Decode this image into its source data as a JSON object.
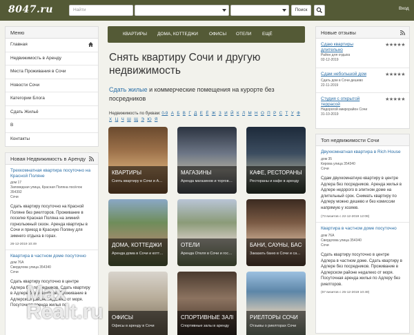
{
  "header": {
    "logo": "8047.ru",
    "search_placeholder": "Найти",
    "search_button": "Поиск",
    "login": "Вход"
  },
  "left_menu": {
    "title": "Меню",
    "items": [
      {
        "label": "Главная"
      },
      {
        "label": "Недвижимость в Аренду"
      },
      {
        "label": "Места Проживания в Сочи"
      },
      {
        "label": "Новости Сочи"
      },
      {
        "label": "Категории Блога"
      },
      {
        "label": "Сдать Жильё"
      },
      {
        "label": "В"
      },
      {
        "label": "Контакты"
      }
    ]
  },
  "new_listings": {
    "title": "Новая Недвижимость в Аренду",
    "items": [
      {
        "title": "Трехкомнатная квартира посуточно на Красной Поляне",
        "line1": "дом 17",
        "line2": "Заповедная улица, Красная Поляна посёлок",
        "line3": "354392",
        "line4": "Сочи",
        "text": "Сдать квартиру посуточно на Красной Поляне без риелторов. Проживание в поселке Красная Поляна на зимний горнолыжный сезон. Аренда квартиры в Сочи и приезд в Красную Поляну для зимнего отдыха в горах.",
        "date": "26-12-2019 10:49"
      },
      {
        "title": "Квартира в частном доме посуточно",
        "line1": "дом 76А",
        "line2": "Свердлова улица 354340",
        "line3": "Сочи",
        "text": "Сдать квартиру посуточно в центре Адлера без посредников. Сдать квартиру в Адлере без риелторов. Проживание в Адлерском районе недалеко от моря. Посуточная аренда жилья по"
      }
    ]
  },
  "main": {
    "nav": [
      "КВАРТИРЫ",
      "ДОМА, КОТТЕДЖИ",
      "ОФИСЫ",
      "ОТЕЛИ",
      "ЕЩЁ"
    ],
    "title": "Снять квартиру Сочи и другую недвижимость",
    "intro_link": "Сдать жилые",
    "intro_rest": " и коммерческие помещения на курорте без посредников",
    "letters_label": "Недвижимость по буквам:",
    "letters": [
      "0-9",
      "А",
      "Б",
      "В",
      "Г",
      "Д",
      "Е",
      "Ё",
      "Ж",
      "З",
      "И",
      "Й",
      "К",
      "Л",
      "М",
      "Н",
      "О",
      "П",
      "Р",
      "С",
      "Т",
      "У",
      "Ф",
      "Х",
      "Ц",
      "Ч",
      "Ш",
      "Щ",
      "Э",
      "Ю",
      "Я"
    ],
    "tiles": [
      {
        "title": "КВАРТИРЫ",
        "subtitle": "Снять квартиру в Сочи и Адлере"
      },
      {
        "title": "МАГАЗИНЫ",
        "subtitle": "Аренда магазинов и торговых"
      },
      {
        "title": "КАФЕ, РЕСТОРАНЫ",
        "subtitle": "Рестораны и кафе в аренду"
      },
      {
        "title": "ДОМА, КОТТЕДЖИ",
        "subtitle": "Аренда дома в Сочи и коттеджа"
      },
      {
        "title": "ОТЕЛИ",
        "subtitle": "Аренда Отеля в Сочи и гостиницы"
      },
      {
        "title": "БАНИ, САУНЫ, БАССЕЙНЫ",
        "subtitle": "Заказать баню в Сочи и сауну"
      },
      {
        "title": "ОФИСЫ",
        "subtitle": "Офисы в аренду в Сочи"
      },
      {
        "title": "СПОРТИВНЫЕ ЗАЛЫ",
        "subtitle": "Спортивные залы в аренду"
      },
      {
        "title": "РИЕЛТОРЫ СОЧИ",
        "subtitle": "Отзывы о риелторах Сочи"
      }
    ]
  },
  "reviews": {
    "title": "Новые отзывы",
    "items": [
      {
        "title": "Сдаю квартиры длительно",
        "sub": "Район для отдыха",
        "date": "02-12-2019"
      },
      {
        "title": "Сдам небольшой дом",
        "sub": "Сдать дом в Сочи дешево",
        "date": "22-11-2019"
      },
      {
        "title": "Студия с открытой террасой",
        "sub": "Недорогой микрорайон Сочи",
        "date": "31-10-2019"
      }
    ]
  },
  "top": {
    "title": "Топ недвижимости Сочи",
    "items": [
      {
        "title": "Двухкомнатная квартира в Rich House",
        "line1": "дом 35",
        "line2": "Кирова улица 354340",
        "line3": "Сочи",
        "text": "Сдам двухкомнатную квартиру в центре Адлера без посредников. Аренда жилья в Адлере недорого в элитном доме на длительный срок. Снимать квартиру по Адлеру можно дешево и без комиссии напрямую у хозяев.",
        "date": "(73 визитов с 22-12-2019 12:08)"
      },
      {
        "title": "Квартира в частном доме посуточно",
        "line1": "дом 76А",
        "line2": "Свердлова улица 354340",
        "line3": "Сочи",
        "text": "Сдать квартиру посуточно в центре Адлера в частном доме. Сдать квартиру в Адлере без посредников. Проживание в Адлерском районе недалеко от моря. Посуточная аренда жилья по Адлеру без риелторов.",
        "date": "(67 визитов с 25-12-2019 10:49)"
      }
    ]
  },
  "watermark": {
    "line1": "Max",
    "line2": "Realt.ru"
  },
  "colors": {
    "brand": "#545a36",
    "link": "#2a6ea6",
    "background": "#f2f2ec"
  }
}
